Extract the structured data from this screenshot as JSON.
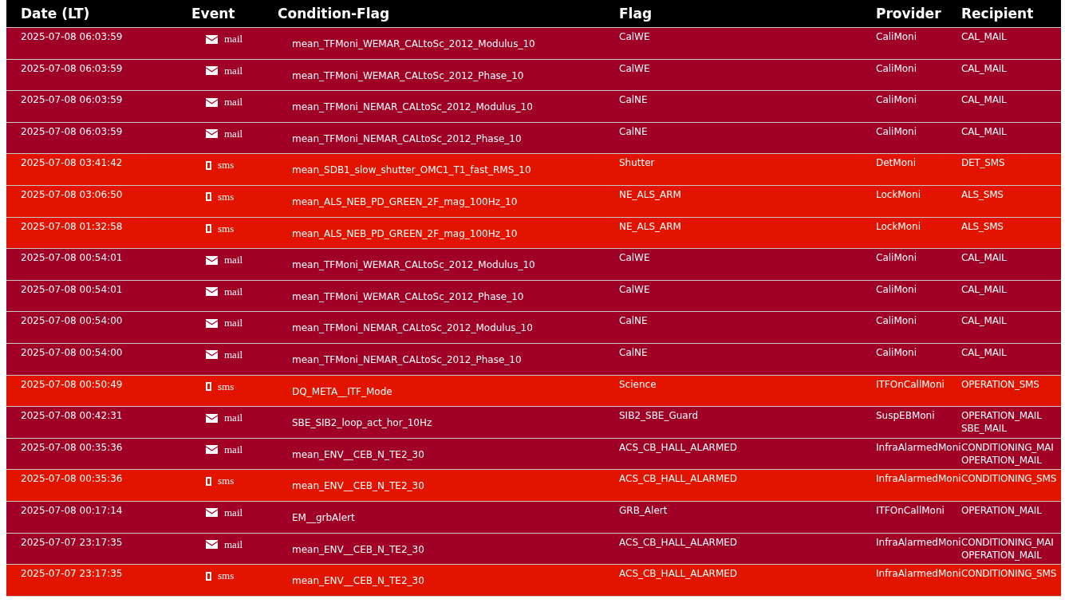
{
  "table": {
    "columns": [
      "Date (LT)",
      "Event",
      "Condition-Flag",
      "Flag",
      "Provider",
      "Recipient"
    ],
    "rows": [
      {
        "date": "2025-07-08 06:03:59",
        "event": {
          "kind": "mail",
          "label": "mail"
        },
        "condition": "mean_TFMoni_WEMAR_CALtoSc_2012_Modulus_10",
        "flag": "CalWE",
        "provider": "CaliMoni",
        "recipients": [
          "CAL_MAIL"
        ]
      },
      {
        "date": "2025-07-08 06:03:59",
        "event": {
          "kind": "mail",
          "label": "mail"
        },
        "condition": "mean_TFMoni_WEMAR_CALtoSc_2012_Phase_10",
        "flag": "CalWE",
        "provider": "CaliMoni",
        "recipients": [
          "CAL_MAIL"
        ]
      },
      {
        "date": "2025-07-08 06:03:59",
        "event": {
          "kind": "mail",
          "label": "mail"
        },
        "condition": "mean_TFMoni_NEMAR_CALtoSc_2012_Modulus_10",
        "flag": "CalNE",
        "provider": "CaliMoni",
        "recipients": [
          "CAL_MAIL"
        ]
      },
      {
        "date": "2025-07-08 06:03:59",
        "event": {
          "kind": "mail",
          "label": "mail"
        },
        "condition": "mean_TFMoni_NEMAR_CALtoSc_2012_Phase_10",
        "flag": "CalNE",
        "provider": "CaliMoni",
        "recipients": [
          "CAL_MAIL"
        ]
      },
      {
        "date": "2025-07-08 03:41:42",
        "event": {
          "kind": "sms",
          "label": "sms"
        },
        "condition": "mean_SDB1_slow_shutter_OMC1_T1_fast_RMS_10",
        "flag": "Shutter",
        "provider": "DetMoni",
        "recipients": [
          "DET_SMS"
        ]
      },
      {
        "date": "2025-07-08 03:06:50",
        "event": {
          "kind": "sms",
          "label": "sms"
        },
        "condition": "mean_ALS_NEB_PD_GREEN_2F_mag_100Hz_10",
        "flag": "NE_ALS_ARM",
        "provider": "LockMoni",
        "recipients": [
          "ALS_SMS"
        ]
      },
      {
        "date": "2025-07-08 01:32:58",
        "event": {
          "kind": "sms",
          "label": "sms"
        },
        "condition": "mean_ALS_NEB_PD_GREEN_2F_mag_100Hz_10",
        "flag": "NE_ALS_ARM",
        "provider": "LockMoni",
        "recipients": [
          "ALS_SMS"
        ]
      },
      {
        "date": "2025-07-08 00:54:01",
        "event": {
          "kind": "mail",
          "label": "mail"
        },
        "condition": "mean_TFMoni_WEMAR_CALtoSc_2012_Modulus_10",
        "flag": "CalWE",
        "provider": "CaliMoni",
        "recipients": [
          "CAL_MAIL"
        ]
      },
      {
        "date": "2025-07-08 00:54:01",
        "event": {
          "kind": "mail",
          "label": "mail"
        },
        "condition": "mean_TFMoni_WEMAR_CALtoSc_2012_Phase_10",
        "flag": "CalWE",
        "provider": "CaliMoni",
        "recipients": [
          "CAL_MAIL"
        ]
      },
      {
        "date": "2025-07-08 00:54:00",
        "event": {
          "kind": "mail",
          "label": "mail"
        },
        "condition": "mean_TFMoni_NEMAR_CALtoSc_2012_Modulus_10",
        "flag": "CalNE",
        "provider": "CaliMoni",
        "recipients": [
          "CAL_MAIL"
        ]
      },
      {
        "date": "2025-07-08 00:54:00",
        "event": {
          "kind": "mail",
          "label": "mail"
        },
        "condition": "mean_TFMoni_NEMAR_CALtoSc_2012_Phase_10",
        "flag": "CalNE",
        "provider": "CaliMoni",
        "recipients": [
          "CAL_MAIL"
        ]
      },
      {
        "date": "2025-07-08 00:50:49",
        "event": {
          "kind": "sms",
          "label": "sms"
        },
        "condition": "DQ_META__ITF_Mode",
        "flag": "Science",
        "provider": "ITFOnCallMoni",
        "recipients": [
          "OPERATION_SMS"
        ]
      },
      {
        "date": "2025-07-08 00:42:31",
        "event": {
          "kind": "mail",
          "label": "mail"
        },
        "condition": "SBE_SIB2_loop_act_hor_10Hz",
        "flag": "SIB2_SBE_Guard",
        "provider": "SuspEBMoni",
        "recipients": [
          "OPERATION_MAIL",
          "SBE_MAIL"
        ]
      },
      {
        "date": "2025-07-08 00:35:36",
        "event": {
          "kind": "mail",
          "label": "mail"
        },
        "condition": "mean_ENV__CEB_N_TE2_30",
        "flag": "ACS_CB_HALL_ALARMED",
        "provider": "InfraAlarmedMoni",
        "recipients": [
          "CONDITIONING_MAI",
          "OPERATION_MAIL"
        ]
      },
      {
        "date": "2025-07-08 00:35:36",
        "event": {
          "kind": "sms",
          "label": "sms"
        },
        "condition": "mean_ENV__CEB_N_TE2_30",
        "flag": "ACS_CB_HALL_ALARMED",
        "provider": "InfraAlarmedMoni",
        "recipients": [
          "CONDITIONING_SMS"
        ]
      },
      {
        "date": "2025-07-08 00:17:14",
        "event": {
          "kind": "mail",
          "label": "mail"
        },
        "condition": "EM__grbAlert",
        "flag": "GRB_Alert",
        "provider": "ITFOnCallMoni",
        "recipients": [
          "OPERATION_MAIL"
        ]
      },
      {
        "date": "2025-07-07 23:17:35",
        "event": {
          "kind": "mail",
          "label": "mail"
        },
        "condition": "mean_ENV__CEB_N_TE2_30",
        "flag": "ACS_CB_HALL_ALARMED",
        "provider": "InfraAlarmedMoni",
        "recipients": [
          "CONDITIONING_MAI",
          "OPERATION_MAIL"
        ]
      },
      {
        "date": "2025-07-07 23:17:35",
        "event": {
          "kind": "sms",
          "label": "sms"
        },
        "condition": "mean_ENV__CEB_N_TE2_30",
        "flag": "ACS_CB_HALL_ALARMED",
        "provider": "InfraAlarmedMoni",
        "recipients": [
          "CONDITIONING_SMS"
        ]
      }
    ]
  }
}
